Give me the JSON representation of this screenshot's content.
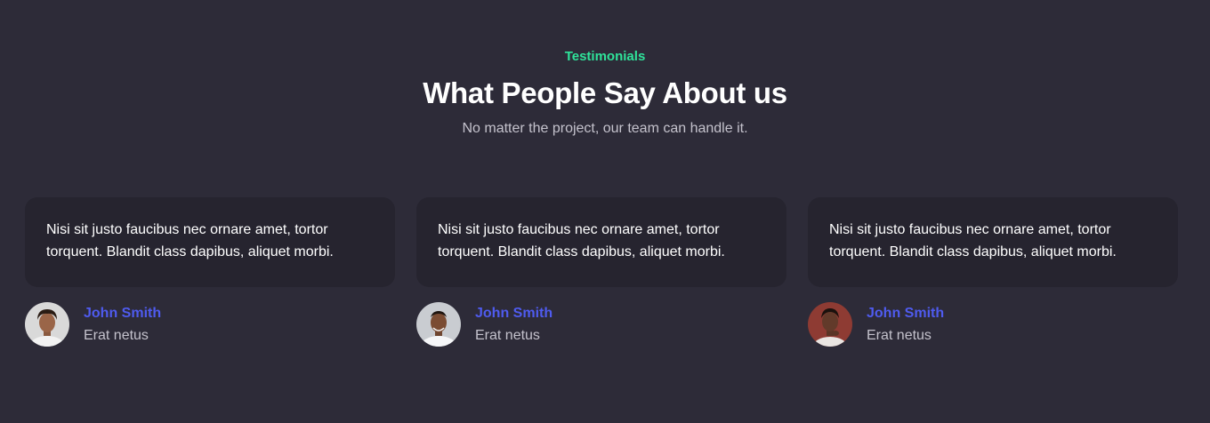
{
  "header": {
    "eyebrow": "Testimonials",
    "title": "What People Say About us",
    "subtitle": "No matter the project, our team can handle it."
  },
  "testimonials": [
    {
      "quote": "Nisi sit justo faucibus nec ornare amet, tortor torquent. Blandit class dapibus, aliquet morbi.",
      "name": "John Smith",
      "role": "Erat netus"
    },
    {
      "quote": "Nisi sit justo faucibus nec ornare amet, tortor torquent. Blandit class dapibus, aliquet morbi.",
      "name": "John Smith",
      "role": "Erat netus"
    },
    {
      "quote": "Nisi sit justo faucibus nec ornare amet, tortor torquent. Blandit class dapibus, aliquet morbi.",
      "name": "John Smith",
      "role": "Erat netus"
    }
  ],
  "colors": {
    "background": "#2d2b38",
    "card": "#26242f",
    "accent_green": "#2fe39a",
    "accent_blue": "#4f5bef"
  }
}
